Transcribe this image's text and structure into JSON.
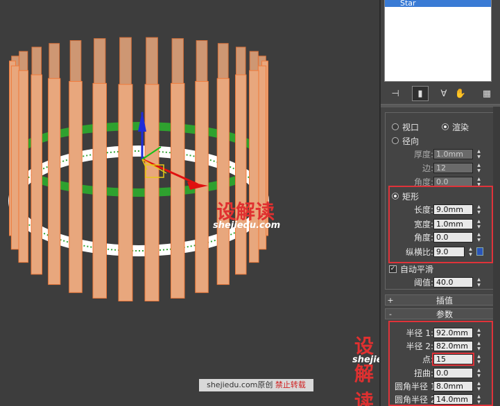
{
  "stack": {
    "selected_item": "Star"
  },
  "toolbar": {
    "pin_icon": "pin-stack-icon",
    "show_end_icon": "show-end-result-icon",
    "unique_icon": "make-unique-icon",
    "remove_icon": "remove-modifier-icon",
    "configure_icon": "configure-modifier-sets-icon"
  },
  "rendering": {
    "viewport_label": "视口",
    "render_label": "渲染",
    "radial_label": "径向",
    "radial_thickness_label": "厚度:",
    "radial_thickness_value": "1.0mm",
    "radial_sides_label": "边:",
    "radial_sides_value": "12",
    "radial_angle_label": "角度:",
    "radial_angle_value": "0.0",
    "rect_label": "矩形",
    "length_label": "长度:",
    "length_value": "9.0mm",
    "width_label": "宽度:",
    "width_value": "1.0mm",
    "rect_angle_label": "角度:",
    "rect_angle_value": "0.0",
    "aspect_label": "纵横比:",
    "aspect_value": "9.0",
    "autosmooth_label": "自动平滑",
    "threshold_label": "阈值:",
    "threshold_value": "40.0"
  },
  "rollouts": {
    "interpolation": {
      "sign": "+",
      "title": "插值"
    },
    "parameters": {
      "sign": "-",
      "title": "参数"
    }
  },
  "parameters": {
    "radius1_label": "半径 1:",
    "radius1_value": "92.0mm",
    "radius2_label": "半径 2:",
    "radius2_value": "82.0mm",
    "points_label": "点:",
    "points_value": "15",
    "distortion_label": "扭曲:",
    "distortion_value": "0.0",
    "fillet1_label": "圆角半径 1:",
    "fillet1_value": "8.0mm",
    "fillet2_label": "圆角半径 2:",
    "fillet2_value": "14.0mm"
  },
  "watermarks": {
    "logo_text": "设解读",
    "url": "shejiedu.com",
    "footer_site": "shejiedu.com原创",
    "footer_warning": "禁止转载"
  },
  "colors": {
    "slat_fill": "#e8a77d",
    "slat_edge": "#f07a3a",
    "ring_green": "#2fa12f",
    "highlight_red": "#e0333a",
    "selection_blue": "#3a7bd5"
  }
}
